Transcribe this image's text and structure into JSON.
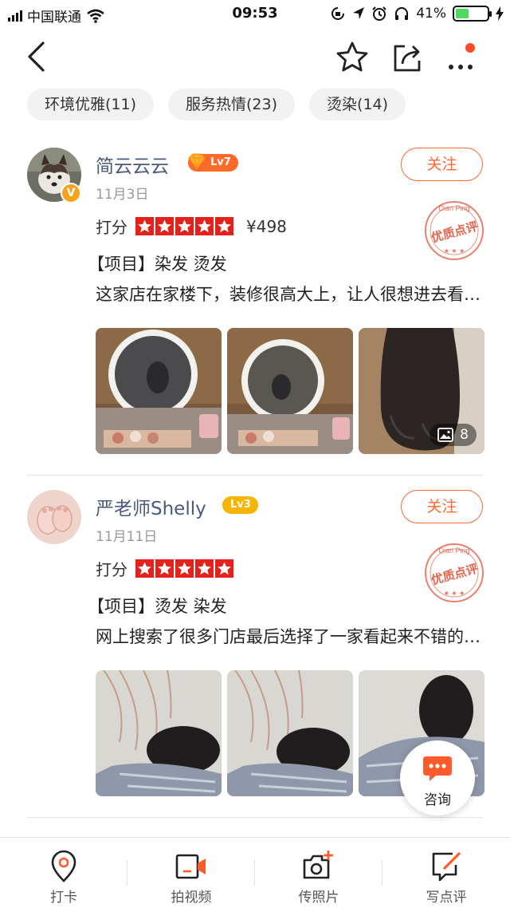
{
  "status_bar": {
    "carrier": "中国联通",
    "time": "09:53",
    "battery": "41%",
    "battery_level": 0.41
  },
  "nav": {
    "back_icon": "chevron-left-icon",
    "favorite_icon": "star-outline-icon",
    "share_icon": "share-icon",
    "more_icon": "more-dots-icon",
    "notify_color": "#ff4a26"
  },
  "tags": [
    {
      "label": "环境优雅(11)"
    },
    {
      "label": "服务热情(23)"
    },
    {
      "label": "烫染(14)"
    }
  ],
  "reviews": [
    {
      "username": "简云云云",
      "level": "Lv7",
      "level_color": "#ff6a2b",
      "verified_mark": "V",
      "date": "11月3日",
      "follow": "关注",
      "score_label": "打分",
      "rating": 5,
      "price": "¥498",
      "project": "【项目】染发 烫发",
      "content": "这家店在家楼下，装修很高大上，让人很想进去看看，服务也很好",
      "photo_count": "8"
    },
    {
      "username": "严老师Shelly",
      "level": "Lv3",
      "level_color": "#f7b500",
      "date": "11月11日",
      "follow": "关注",
      "score_label": "打分",
      "rating": 5,
      "project": "【项目】烫发 染发",
      "content": "网上搜索了很多门店最后选择了一家看起来不错的店，效果很满意"
    }
  ],
  "stamp": {
    "text": "优质点评",
    "top_text": "Dian Ping",
    "color": "#e2492f"
  },
  "consult": {
    "label": "咨询"
  },
  "bottom_bar": [
    {
      "label": "打卡",
      "icon": "location-pin-icon"
    },
    {
      "label": "拍视频",
      "icon": "video-icon"
    },
    {
      "label": "传照片",
      "icon": "camera-plus-icon"
    },
    {
      "label": "写点评",
      "icon": "write-review-icon"
    }
  ],
  "colors": {
    "accent": "#ff6633",
    "star_bg": "#e4221b",
    "username": "#4a5a7a"
  }
}
